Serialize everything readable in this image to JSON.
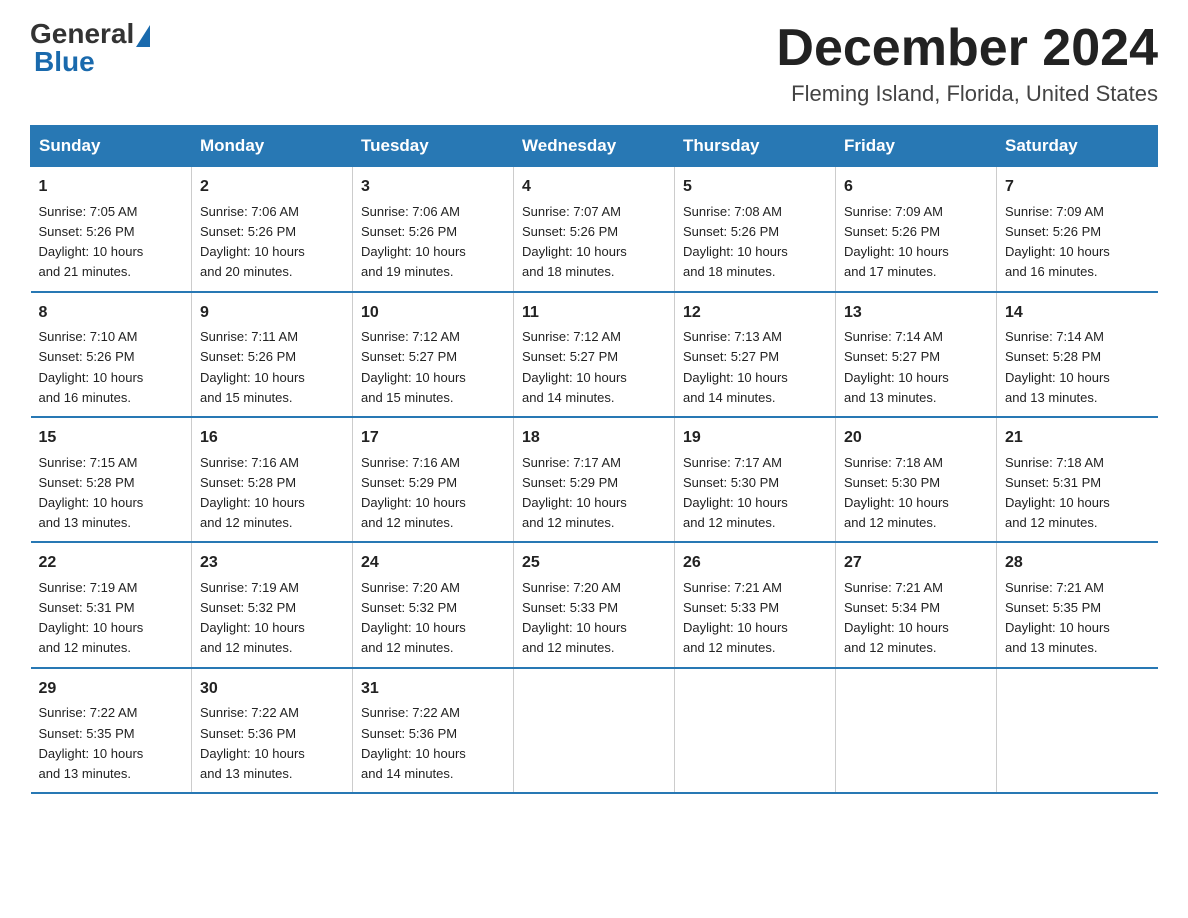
{
  "logo": {
    "general": "General",
    "blue": "Blue"
  },
  "title": "December 2024",
  "location": "Fleming Island, Florida, United States",
  "days_of_week": [
    "Sunday",
    "Monday",
    "Tuesday",
    "Wednesday",
    "Thursday",
    "Friday",
    "Saturday"
  ],
  "weeks": [
    [
      {
        "num": "1",
        "info": "Sunrise: 7:05 AM\nSunset: 5:26 PM\nDaylight: 10 hours\nand 21 minutes."
      },
      {
        "num": "2",
        "info": "Sunrise: 7:06 AM\nSunset: 5:26 PM\nDaylight: 10 hours\nand 20 minutes."
      },
      {
        "num": "3",
        "info": "Sunrise: 7:06 AM\nSunset: 5:26 PM\nDaylight: 10 hours\nand 19 minutes."
      },
      {
        "num": "4",
        "info": "Sunrise: 7:07 AM\nSunset: 5:26 PM\nDaylight: 10 hours\nand 18 minutes."
      },
      {
        "num": "5",
        "info": "Sunrise: 7:08 AM\nSunset: 5:26 PM\nDaylight: 10 hours\nand 18 minutes."
      },
      {
        "num": "6",
        "info": "Sunrise: 7:09 AM\nSunset: 5:26 PM\nDaylight: 10 hours\nand 17 minutes."
      },
      {
        "num": "7",
        "info": "Sunrise: 7:09 AM\nSunset: 5:26 PM\nDaylight: 10 hours\nand 16 minutes."
      }
    ],
    [
      {
        "num": "8",
        "info": "Sunrise: 7:10 AM\nSunset: 5:26 PM\nDaylight: 10 hours\nand 16 minutes."
      },
      {
        "num": "9",
        "info": "Sunrise: 7:11 AM\nSunset: 5:26 PM\nDaylight: 10 hours\nand 15 minutes."
      },
      {
        "num": "10",
        "info": "Sunrise: 7:12 AM\nSunset: 5:27 PM\nDaylight: 10 hours\nand 15 minutes."
      },
      {
        "num": "11",
        "info": "Sunrise: 7:12 AM\nSunset: 5:27 PM\nDaylight: 10 hours\nand 14 minutes."
      },
      {
        "num": "12",
        "info": "Sunrise: 7:13 AM\nSunset: 5:27 PM\nDaylight: 10 hours\nand 14 minutes."
      },
      {
        "num": "13",
        "info": "Sunrise: 7:14 AM\nSunset: 5:27 PM\nDaylight: 10 hours\nand 13 minutes."
      },
      {
        "num": "14",
        "info": "Sunrise: 7:14 AM\nSunset: 5:28 PM\nDaylight: 10 hours\nand 13 minutes."
      }
    ],
    [
      {
        "num": "15",
        "info": "Sunrise: 7:15 AM\nSunset: 5:28 PM\nDaylight: 10 hours\nand 13 minutes."
      },
      {
        "num": "16",
        "info": "Sunrise: 7:16 AM\nSunset: 5:28 PM\nDaylight: 10 hours\nand 12 minutes."
      },
      {
        "num": "17",
        "info": "Sunrise: 7:16 AM\nSunset: 5:29 PM\nDaylight: 10 hours\nand 12 minutes."
      },
      {
        "num": "18",
        "info": "Sunrise: 7:17 AM\nSunset: 5:29 PM\nDaylight: 10 hours\nand 12 minutes."
      },
      {
        "num": "19",
        "info": "Sunrise: 7:17 AM\nSunset: 5:30 PM\nDaylight: 10 hours\nand 12 minutes."
      },
      {
        "num": "20",
        "info": "Sunrise: 7:18 AM\nSunset: 5:30 PM\nDaylight: 10 hours\nand 12 minutes."
      },
      {
        "num": "21",
        "info": "Sunrise: 7:18 AM\nSunset: 5:31 PM\nDaylight: 10 hours\nand 12 minutes."
      }
    ],
    [
      {
        "num": "22",
        "info": "Sunrise: 7:19 AM\nSunset: 5:31 PM\nDaylight: 10 hours\nand 12 minutes."
      },
      {
        "num": "23",
        "info": "Sunrise: 7:19 AM\nSunset: 5:32 PM\nDaylight: 10 hours\nand 12 minutes."
      },
      {
        "num": "24",
        "info": "Sunrise: 7:20 AM\nSunset: 5:32 PM\nDaylight: 10 hours\nand 12 minutes."
      },
      {
        "num": "25",
        "info": "Sunrise: 7:20 AM\nSunset: 5:33 PM\nDaylight: 10 hours\nand 12 minutes."
      },
      {
        "num": "26",
        "info": "Sunrise: 7:21 AM\nSunset: 5:33 PM\nDaylight: 10 hours\nand 12 minutes."
      },
      {
        "num": "27",
        "info": "Sunrise: 7:21 AM\nSunset: 5:34 PM\nDaylight: 10 hours\nand 12 minutes."
      },
      {
        "num": "28",
        "info": "Sunrise: 7:21 AM\nSunset: 5:35 PM\nDaylight: 10 hours\nand 13 minutes."
      }
    ],
    [
      {
        "num": "29",
        "info": "Sunrise: 7:22 AM\nSunset: 5:35 PM\nDaylight: 10 hours\nand 13 minutes."
      },
      {
        "num": "30",
        "info": "Sunrise: 7:22 AM\nSunset: 5:36 PM\nDaylight: 10 hours\nand 13 minutes."
      },
      {
        "num": "31",
        "info": "Sunrise: 7:22 AM\nSunset: 5:36 PM\nDaylight: 10 hours\nand 14 minutes."
      },
      {
        "num": "",
        "info": ""
      },
      {
        "num": "",
        "info": ""
      },
      {
        "num": "",
        "info": ""
      },
      {
        "num": "",
        "info": ""
      }
    ]
  ]
}
